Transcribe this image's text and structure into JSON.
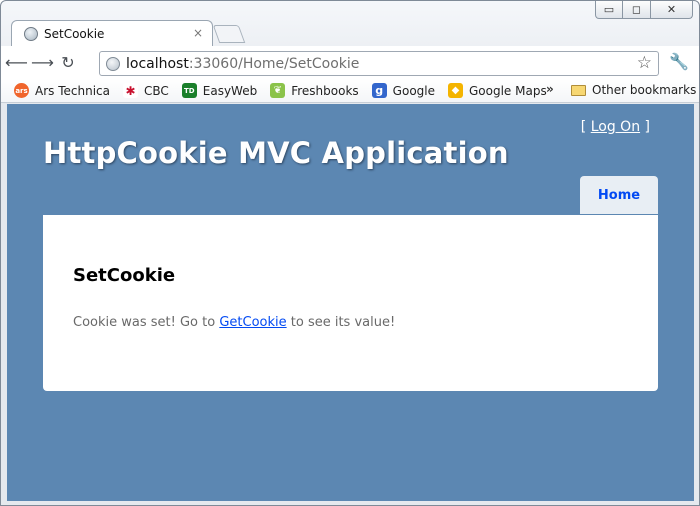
{
  "browser": {
    "tab_title": "SetCookie",
    "tab_close": "×",
    "url_host": "localhost",
    "url_rest": ":33060/Home/SetCookie",
    "window_controls": [
      "▭",
      "◻",
      "✕"
    ]
  },
  "bookmarks": {
    "items": [
      {
        "label": "Ars Technica",
        "icon": "ars-icon",
        "color": "#f0652c",
        "glyph": "ars"
      },
      {
        "label": "CBC",
        "icon": "cbc-icon",
        "color": "#c8102e",
        "glyph": "✱"
      },
      {
        "label": "EasyWeb",
        "icon": "td-icon",
        "color": "#1a7f2a",
        "glyph": "TD"
      },
      {
        "label": "Freshbooks",
        "icon": "freshbooks-icon",
        "color": "#8bc34a",
        "glyph": "❦"
      },
      {
        "label": "Google",
        "icon": "google-icon",
        "color": "#3366cc",
        "glyph": "g"
      },
      {
        "label": "Google Maps",
        "icon": "google-maps-icon",
        "color": "#f4b400",
        "glyph": "◆"
      }
    ],
    "more": "»",
    "other": "Other bookmarks"
  },
  "page": {
    "logon_open": "[",
    "logon_link": "Log On",
    "logon_close": "]",
    "title": "HttpCookie MVC Application",
    "menu_home": "Home",
    "heading": "SetCookie",
    "text_before": "Cookie was set! Go to ",
    "link_text": "GetCookie",
    "text_after": " to see its value!"
  },
  "colors": {
    "page_background": "#5c87b2",
    "link": "#034af3"
  }
}
